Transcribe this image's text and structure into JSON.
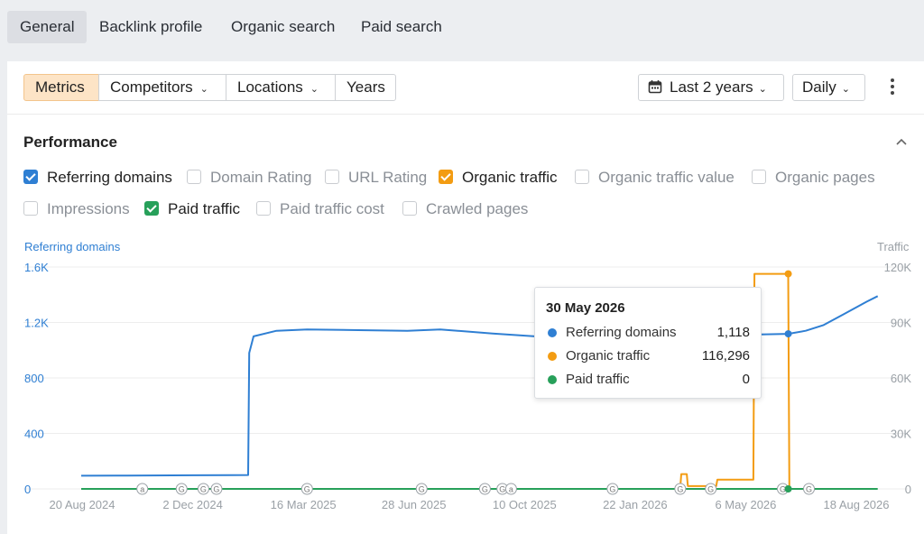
{
  "nav": {
    "tabs": [
      {
        "label": "General",
        "active": true
      },
      {
        "label": "Backlink profile"
      },
      {
        "label": "Organic search"
      },
      {
        "label": "Paid search"
      }
    ]
  },
  "toolbar": {
    "metrics": "Metrics",
    "competitors": "Competitors",
    "locations": "Locations",
    "years": "Years",
    "date_range": "Last 2 years",
    "granularity": "Daily",
    "more_icon": "kebab-vertical-icon",
    "calendar_icon": "calendar-icon"
  },
  "performance": {
    "title": "Performance",
    "collapse_icon": "chevron-up-icon",
    "checkboxes": [
      {
        "label": "Referring domains",
        "checked": true,
        "color": "#2f7fd3"
      },
      {
        "label": "Domain Rating",
        "checked": false
      },
      {
        "label": "URL Rating",
        "checked": false
      },
      {
        "label": "Organic traffic",
        "checked": true,
        "color": "#f39c12"
      },
      {
        "label": "Organic traffic value",
        "checked": false
      },
      {
        "label": "Organic pages",
        "checked": false
      },
      {
        "label": "Impressions",
        "checked": false
      },
      {
        "label": "Paid traffic",
        "checked": true,
        "color": "#27a05a"
      },
      {
        "label": "Paid traffic cost",
        "checked": false
      },
      {
        "label": "Crawled pages",
        "checked": false
      }
    ]
  },
  "tooltip": {
    "date": "30 May 2026",
    "rows": [
      {
        "name": "Referring domains",
        "value": "1,118",
        "color": "#2f7fd3"
      },
      {
        "name": "Organic traffic",
        "value": "116,296",
        "color": "#f39c12"
      },
      {
        "name": "Paid traffic",
        "value": "0",
        "color": "#27a05a"
      }
    ]
  },
  "chart_data": {
    "type": "line",
    "left_axis_title": "Referring domains",
    "right_axis_title": "Traffic",
    "left_ticks": [
      "0",
      "400",
      "800",
      "1.2K",
      "1.6K"
    ],
    "left_tick_values": [
      0,
      400,
      800,
      1200,
      1600
    ],
    "right_ticks": [
      "0",
      "30K",
      "60K",
      "90K",
      "120K"
    ],
    "right_tick_values": [
      0,
      30000,
      60000,
      90000,
      120000
    ],
    "x_ticks": [
      "20 Aug 2024",
      "2 Dec 2024",
      "16 Mar 2025",
      "28 Jun 2025",
      "10 Oct 2025",
      "22 Jan 2026",
      "6 May 2026",
      "18 Aug 2026"
    ],
    "x_range": [
      "2024-08-20",
      "2026-08-31"
    ],
    "left_range": [
      0,
      1600
    ],
    "right_range": [
      0,
      120000
    ],
    "grid": true,
    "series": [
      {
        "name": "Referring domains",
        "axis": "left",
        "color": "#2f7fd3",
        "points": [
          [
            "2024-08-20",
            95
          ],
          [
            "2024-10-01",
            96
          ],
          [
            "2024-12-01",
            98
          ],
          [
            "2025-01-20",
            100
          ],
          [
            "2025-01-21",
            980
          ],
          [
            "2025-01-25",
            1100
          ],
          [
            "2025-02-15",
            1140
          ],
          [
            "2025-03-15",
            1150
          ],
          [
            "2025-05-01",
            1145
          ],
          [
            "2025-06-15",
            1140
          ],
          [
            "2025-07-15",
            1150
          ],
          [
            "2025-09-01",
            1120
          ],
          [
            "2025-10-10",
            1100
          ],
          [
            "2025-11-20",
            1090
          ],
          [
            "2025-12-20",
            1085
          ],
          [
            "2026-01-22",
            1100
          ],
          [
            "2026-03-01",
            1105
          ],
          [
            "2026-04-15",
            1110
          ],
          [
            "2026-05-30",
            1118
          ],
          [
            "2026-06-15",
            1140
          ],
          [
            "2026-07-01",
            1180
          ],
          [
            "2026-07-20",
            1260
          ],
          [
            "2026-08-10",
            1350
          ],
          [
            "2026-08-20",
            1390
          ]
        ]
      },
      {
        "name": "Organic traffic",
        "axis": "right",
        "color": "#f39c12",
        "points": [
          [
            "2026-02-20",
            0
          ],
          [
            "2026-02-21",
            8000
          ],
          [
            "2026-02-26",
            8000
          ],
          [
            "2026-02-27",
            1500
          ],
          [
            "2026-03-25",
            1500
          ],
          [
            "2026-03-26",
            5000
          ],
          [
            "2026-04-28",
            5000
          ],
          [
            "2026-04-29",
            116296
          ],
          [
            "2026-05-30",
            116296
          ],
          [
            "2026-05-31",
            0
          ]
        ]
      },
      {
        "name": "Paid traffic",
        "axis": "right",
        "color": "#27a05a",
        "points": [
          [
            "2024-08-20",
            0
          ],
          [
            "2026-08-20",
            0
          ]
        ]
      }
    ],
    "annotations": [
      {
        "date": "2024-10-15",
        "label": "a"
      },
      {
        "date": "2024-11-20",
        "label": "G"
      },
      {
        "date": "2024-12-10",
        "label": "G"
      },
      {
        "date": "2024-12-22",
        "label": "G"
      },
      {
        "date": "2025-03-15",
        "label": "G"
      },
      {
        "date": "2025-06-28",
        "label": "G"
      },
      {
        "date": "2025-08-25",
        "label": "G"
      },
      {
        "date": "2025-09-10",
        "label": "G"
      },
      {
        "date": "2025-09-18",
        "label": "a"
      },
      {
        "date": "2025-12-20",
        "label": "G"
      },
      {
        "date": "2026-02-20",
        "label": "G"
      },
      {
        "date": "2026-03-20",
        "label": "G"
      },
      {
        "date": "2026-05-25",
        "label": "G"
      },
      {
        "date": "2026-06-18",
        "label": "G"
      }
    ]
  }
}
